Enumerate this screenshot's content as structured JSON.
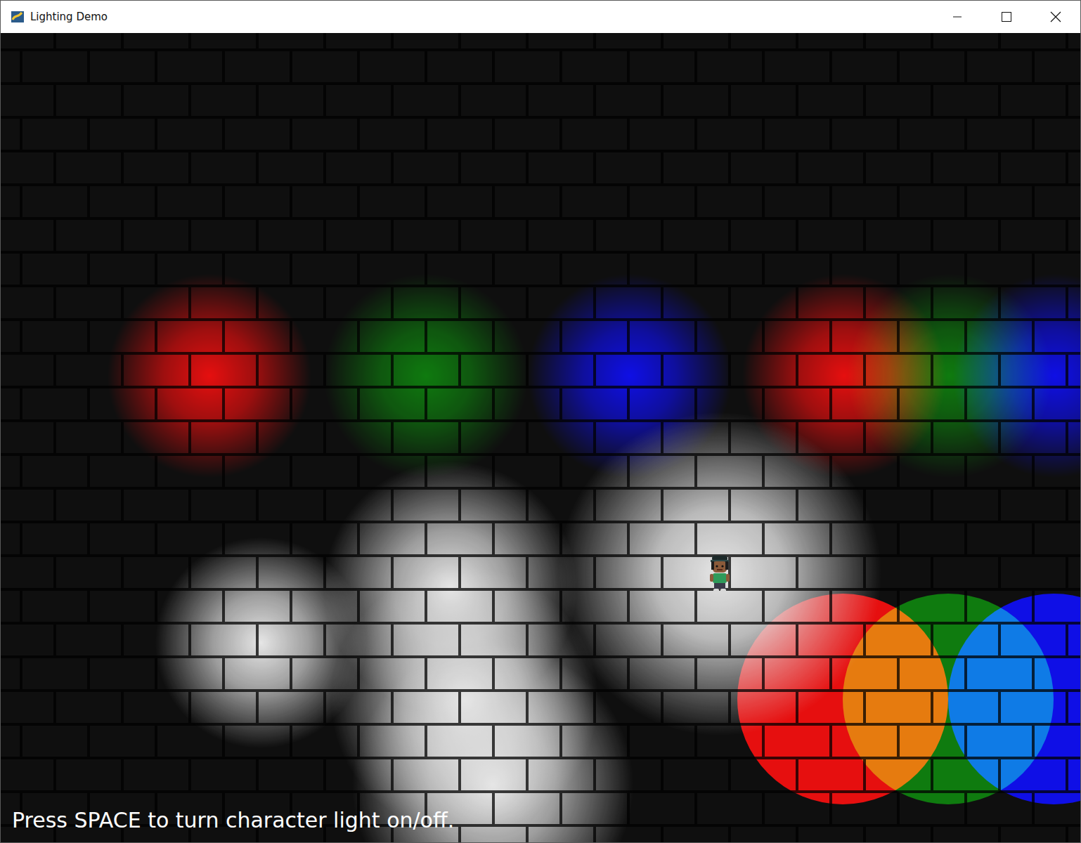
{
  "window": {
    "title": "Lighting Demo"
  },
  "character_light": {
    "on": true
  },
  "lights": [
    {
      "kind": "soft",
      "color": "#ff0000"
    },
    {
      "kind": "soft",
      "color": "#008000"
    },
    {
      "kind": "soft",
      "color": "#0000ff"
    },
    {
      "kind": "soft",
      "color": "#ff0000"
    },
    {
      "kind": "soft",
      "color": "#008000"
    },
    {
      "kind": "soft",
      "color": "#0000ff"
    },
    {
      "kind": "soft",
      "color": "#ffffff"
    },
    {
      "kind": "soft",
      "color": "#ffffff"
    },
    {
      "kind": "soft",
      "color": "#ffffff"
    },
    {
      "kind": "soft",
      "color": "#ffffff"
    },
    {
      "kind": "hard",
      "color": "#ff0000"
    },
    {
      "kind": "hard",
      "color": "#008000"
    },
    {
      "kind": "hard",
      "color": "#0000ff"
    }
  ],
  "hint": "Press SPACE to turn character light on/off."
}
